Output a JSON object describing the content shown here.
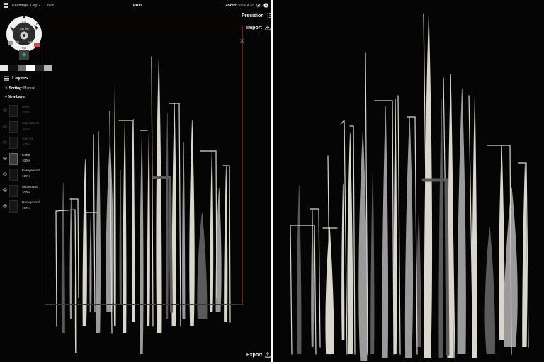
{
  "left": {
    "topbar": {
      "menu_icon": "grid-icon",
      "crumb_1": "Paintings",
      "crumb_2": "City 2",
      "crumb_3": "Color",
      "pro": "PRO",
      "zoom_label": "Zoom:",
      "zoom_value": "65%",
      "rotation": "4.0°",
      "settings_icon": "gear-icon",
      "help_icon": "help-icon"
    },
    "precision_label": "Precision",
    "import_label": "Import",
    "export_label": "Export",
    "tool_wheel": {
      "brush_size": "7.59 mm",
      "opacity_left": "0%",
      "opacity_right": "100%",
      "top_label": "AT8",
      "bottom_label": "N4.1",
      "side_label_1": "P5",
      "side_label_2": "P4",
      "side_label_3": "P2"
    },
    "swatches": [
      "#e8e8e8",
      "#111111",
      "#6e6e6e",
      "#ffffff",
      "#2b2b2b",
      "#b5b5b5"
    ],
    "layers": {
      "title": "Layers",
      "sorting_label": "Sorting:",
      "sorting_value": "Manual",
      "new_layer": "+ New Layer",
      "items": [
        {
          "name": "Spec",
          "opacity": "100%",
          "state": "dim"
        },
        {
          "name": "City Details",
          "opacity": "100%",
          "state": "dim"
        },
        {
          "name": "City Ink",
          "opacity": "100%",
          "state": "dim"
        },
        {
          "name": "Color",
          "opacity": "100%",
          "state": "selected"
        },
        {
          "name": "Foreground",
          "opacity": "100%",
          "state": "bright"
        },
        {
          "name": "Midground",
          "opacity": "100%",
          "state": "bright"
        },
        {
          "name": "Background",
          "opacity": "100%",
          "state": "bright"
        }
      ]
    }
  },
  "colors": {
    "background": "#050505",
    "canvas_border": "#5a2b2b",
    "stroke_light": "#d9d6cc",
    "stroke_mid": "#9a9a9a",
    "stroke_dark": "#5a5a5a"
  }
}
